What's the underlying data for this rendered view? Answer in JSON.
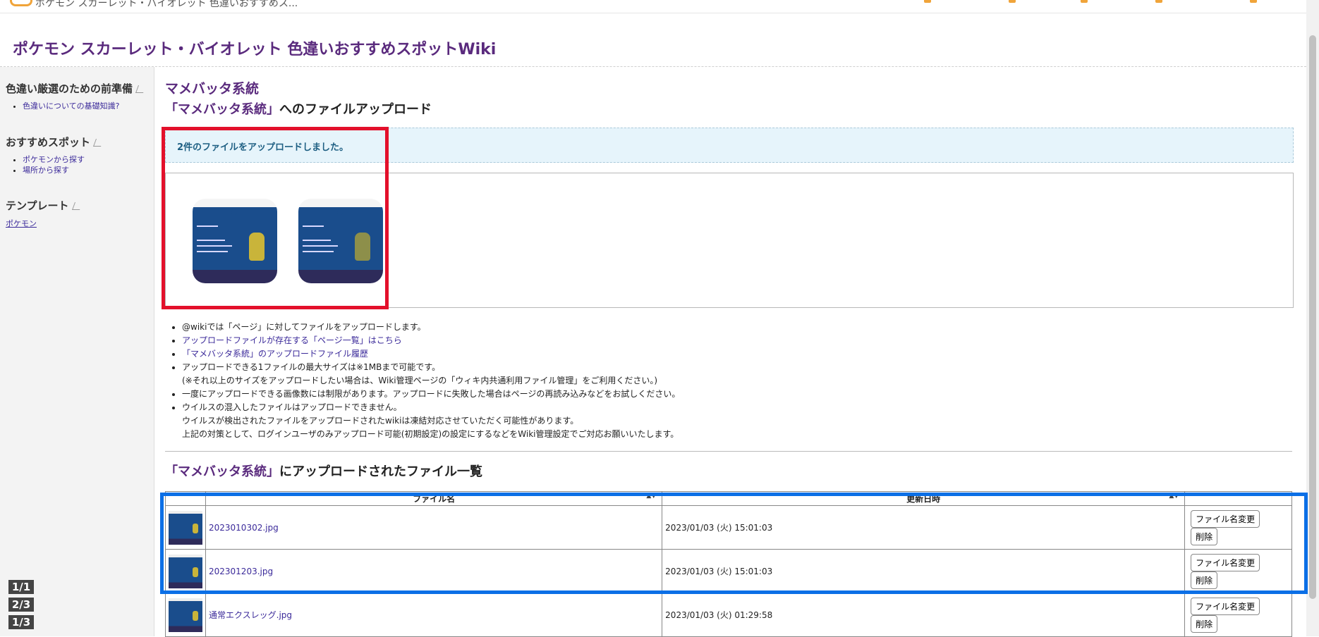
{
  "tab": {
    "title": "ポケモン スカーレット・バイオレット 色違いおすすめス..."
  },
  "site": {
    "title": "ポケモン スカーレット・バイオレット 色違いおすすめスポットWiki"
  },
  "sidebar": {
    "section1": {
      "heading": "色違い厳選のための前準備",
      "items": [
        "色違いについての基礎知識?"
      ]
    },
    "section2": {
      "heading": "おすすめスポット",
      "items": [
        "ポケモンから探す",
        "場所から探す"
      ]
    },
    "section3": {
      "heading": "テンプレート",
      "items": [
        "ポケモン"
      ]
    }
  },
  "pager": {
    "labels": [
      "1/1",
      "2/3",
      "1/3"
    ]
  },
  "page": {
    "heading": "マメバッタ系統",
    "upload_heading_quote": "「マメバッタ系統」",
    "upload_heading_rest": "へのファイルアップロード",
    "notice": "2件のファイルをアップロードしました。"
  },
  "info": {
    "item1": "@wikiでは「ページ」に対してファイルをアップロードします。",
    "item2": "アップロードファイルが存在する「ページ一覧」はこちら",
    "item3": "「マメバッタ系統」のアップロードファイル履歴",
    "item4_line1": "アップロードできる1ファイルの最大サイズは※1MBまで可能です。",
    "item4_line2": "(※それ以上のサイズをアップロードしたい場合は、Wiki管理ページの「ウィキ内共通利用ファイル管理」をご利用ください。)",
    "item5": "一度にアップロードできる画像数には制限があります。アップロードに失敗した場合はページの再読み込みなどをお試しください。",
    "item6_line1": "ウイルスの混入したファイルはアップロードできません。",
    "item6_line2": "ウイルスが検出されたファイルをアップロードされたwikiは凍結対応させていただく可能性があります。",
    "item6_line3": "上記の対策として、ログインユーザのみアップロード可能(初期設定)の設定にするなどをWiki管理設定でご対応お願いいたします。"
  },
  "file_list": {
    "heading_quote": "「マメバッタ系統」",
    "heading_rest": "にアップロードされたファイル一覧",
    "columns": {
      "name": "ファイル名",
      "updated": "更新日時"
    },
    "rows": [
      {
        "name": "2023010302.jpg",
        "updated": "2023/01/03 (火) 15:01:03",
        "rename": "ファイル名変更",
        "delete": "削除"
      },
      {
        "name": "202301203.jpg",
        "updated": "2023/01/03 (火) 15:01:03",
        "rename": "ファイル名変更",
        "delete": "削除"
      },
      {
        "name": "通常エクスレッグ.jpg",
        "updated": "2023/01/03 (火) 01:29:58",
        "rename": "ファイル名変更",
        "delete": "削除"
      }
    ]
  },
  "icons": [
    "upload-icon",
    "edit-icon",
    "sort-icon"
  ],
  "colors": {
    "title_purple": "#5a2a7d",
    "link": "#3b2a9a",
    "highlight_red": "#e3102b",
    "highlight_blue": "#0b6fe6",
    "notice_bg": "#e6f4fb"
  }
}
